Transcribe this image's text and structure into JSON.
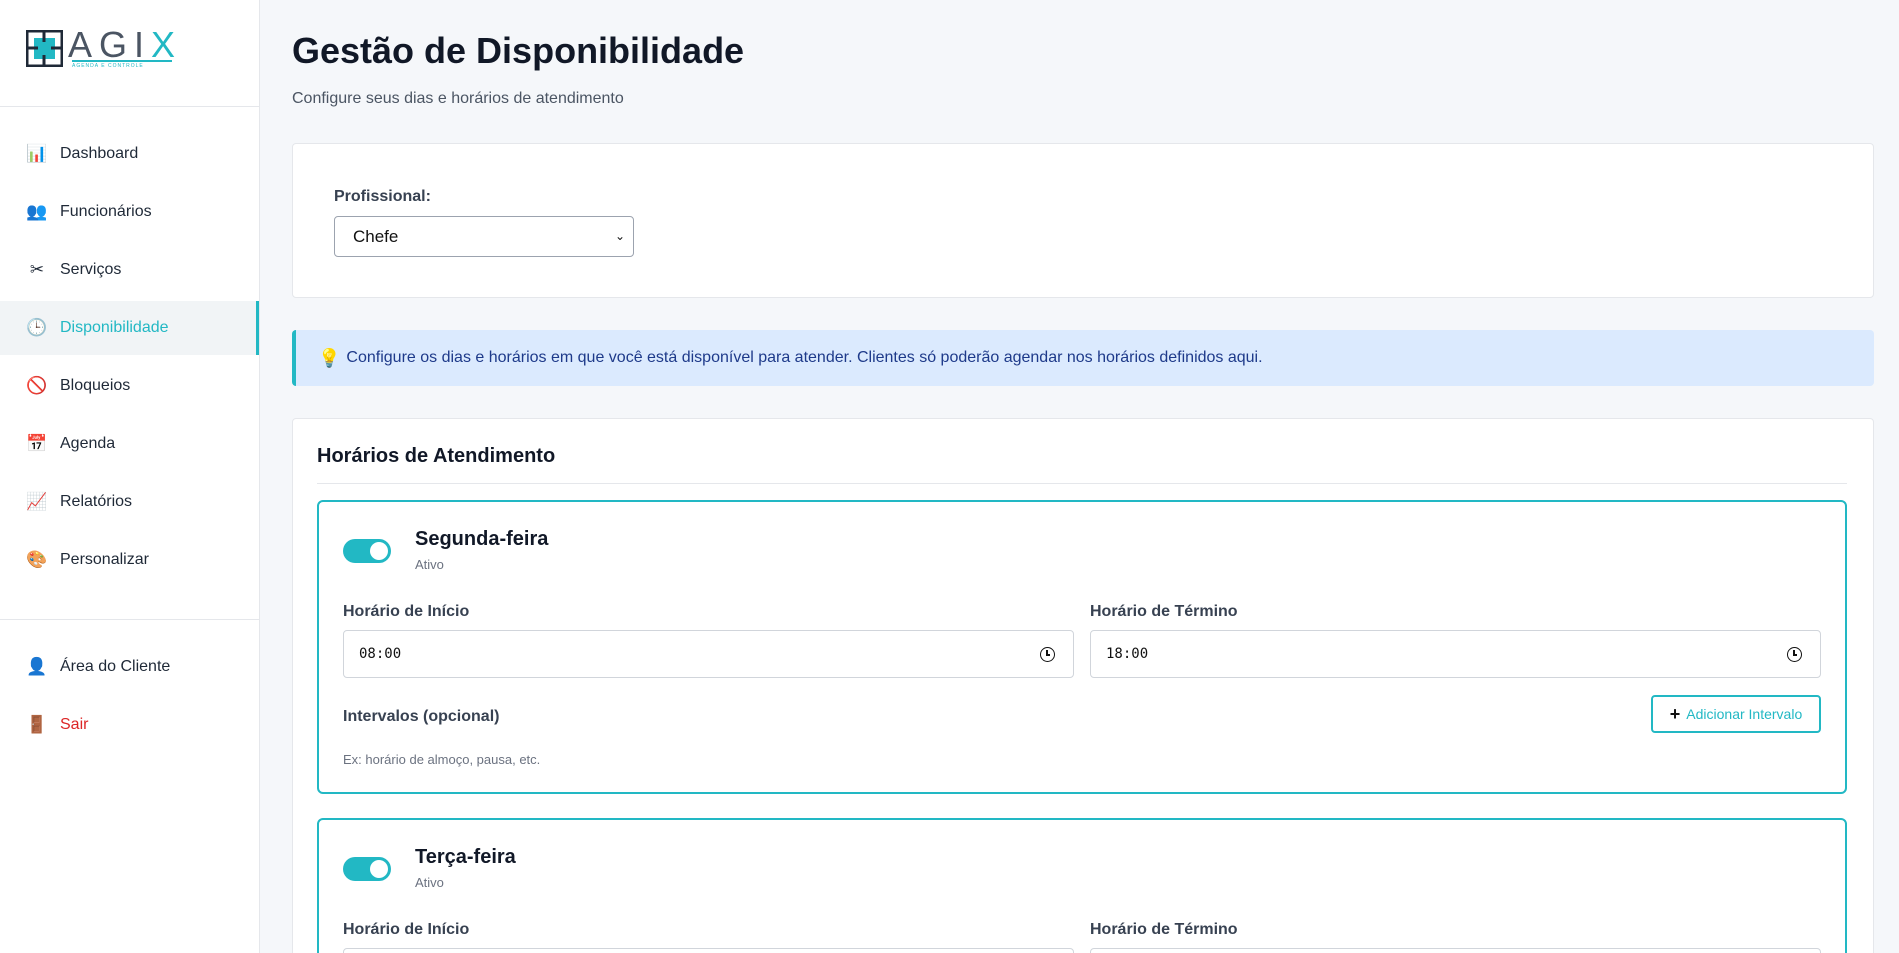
{
  "brand": {
    "name": "AGI",
    "name_x": "X",
    "tagline": "AGENDA E CONTROLE"
  },
  "nav": [
    {
      "icon": "📊",
      "label": "Dashboard"
    },
    {
      "icon": "👥",
      "label": "Funcionários"
    },
    {
      "icon": "✂",
      "label": "Serviços"
    },
    {
      "icon": "🕒",
      "label": "Disponibilidade"
    },
    {
      "icon": "🚫",
      "label": "Bloqueios"
    },
    {
      "icon": "📅",
      "label": "Agenda"
    },
    {
      "icon": "📈",
      "label": "Relatórios"
    },
    {
      "icon": "🎨",
      "label": "Personalizar"
    }
  ],
  "nav_bottom": [
    {
      "icon": "👤",
      "label": "Área do Cliente"
    },
    {
      "icon": "🚪",
      "label": "Sair"
    }
  ],
  "page": {
    "title": "Gestão de Disponibilidade",
    "subtitle": "Configure seus dias e horários de atendimento"
  },
  "professional": {
    "label": "Profissional:",
    "selected": "Chefe"
  },
  "info": {
    "text": "Configure os dias e horários em que você está disponível para atender. Clientes só poderão agendar nos horários definidos aqui."
  },
  "schedule": {
    "title": "Horários de Atendimento",
    "start_label": "Horário de Início",
    "end_label": "Horário de Término",
    "intervals_label": "Intervalos (opcional)",
    "add_interval": "Adicionar Intervalo",
    "hint": "Ex: horário de almoço, pausa, etc.",
    "days": [
      {
        "name": "Segunda-feira",
        "status": "Ativo",
        "start": "08:00",
        "end": "18:00",
        "enabled": true
      },
      {
        "name": "Terça-feira",
        "status": "Ativo",
        "enabled": true
      }
    ]
  },
  "colors": {
    "accent": "#22b8c4",
    "danger": "#dc2626",
    "info_bg": "#dbeafe"
  }
}
